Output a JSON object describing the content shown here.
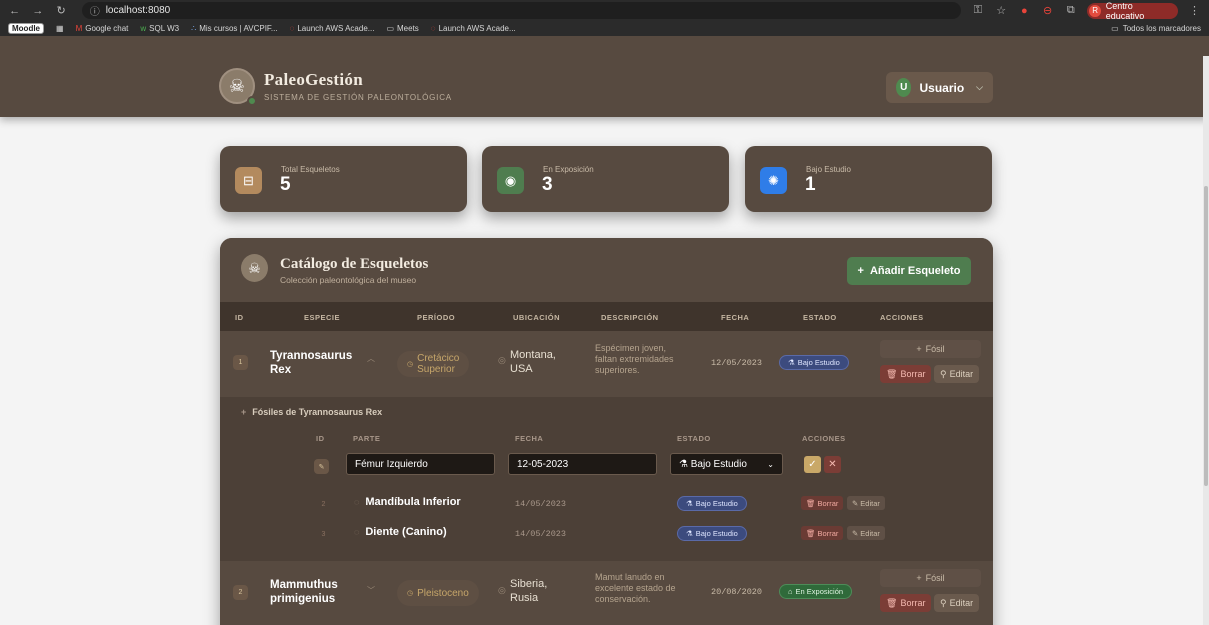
{
  "browser": {
    "url": "localhost:8080",
    "profile_label": "Centro educativo",
    "profile_initial": "R",
    "bookmarks": [
      "Moodle",
      "Google chat",
      "SQL W3",
      "Mis cursos | AVCPIF...",
      "Launch AWS Acade...",
      "Meets",
      "Launch AWS Acade..."
    ],
    "all_bookmarks": "Todos los marcadores"
  },
  "header": {
    "brand": "PaleoGestión",
    "subtitle": "SISTEMA DE GESTIÓN PALEONTOLÓGICA",
    "user_initial": "U",
    "user_label": "Usuario"
  },
  "stats": [
    {
      "label": "Total Esqueletos",
      "value": "5",
      "color": "#b38a5e"
    },
    {
      "label": "En Exposición",
      "value": "3",
      "color": "#4f7d4f"
    },
    {
      "label": "Bajo Estudio",
      "value": "1",
      "color": "#2f7de8"
    }
  ],
  "catalog": {
    "title": "Catálogo de Esqueletos",
    "subtitle": "Colección paleontológica del museo",
    "add_button": "Añadir Esqueleto",
    "columns": [
      "ID",
      "ESPECIE",
      "PERÍODO",
      "UBICACIÓN",
      "DESCRIPCIÓN",
      "FECHA",
      "ESTADO",
      "ACCIONES"
    ],
    "rows": [
      {
        "id": "1",
        "species_1": "Tyrannosaurus",
        "species_2": "Rex",
        "period_1": "Cretácico",
        "period_2": "Superior",
        "location_1": "Montana,",
        "location_2": "USA",
        "desc_1": "Espécimen joven,",
        "desc_2": "faltan extremidades",
        "desc_3": "superiores.",
        "date": "12/05/2023",
        "state": "Bajo Estudio",
        "fossil_btn": "Fósil",
        "delete_btn": "Borrar",
        "edit_btn": "Editar"
      },
      {
        "id": "2",
        "species_1": "Mammuthus",
        "species_2": "primigenius",
        "period_1": "Pleistoceno",
        "location_1": "Siberia,",
        "location_2": "Rusia",
        "desc_1": "Mamut lanudo en",
        "desc_2": "excelente estado de",
        "desc_3": "conservación.",
        "date": "20/08/2020",
        "state": "En Exposición",
        "fossil_btn": "Fósil",
        "delete_btn": "Borrar",
        "edit_btn": "Editar"
      }
    ],
    "fossils": {
      "title": "Fósiles de Tyrannosaurus Rex",
      "columns": [
        "ID",
        "PARTE",
        "FECHA",
        "ESTADO",
        "ACCIONES"
      ],
      "edit_row": {
        "name_value": "Fémur Izquierdo",
        "date_value": "12-05-2023",
        "state_value": "Bajo Estudio"
      },
      "items": [
        {
          "id": "2",
          "name": "Mandíbula Inferior",
          "date": "14/05/2023",
          "state": "Bajo Estudio",
          "delete_btn": "Borrar",
          "edit_btn": "Editar"
        },
        {
          "id": "3",
          "name": "Diente (Canino)",
          "date": "14/05/2023",
          "state": "Bajo Estudio",
          "delete_btn": "Borrar",
          "edit_btn": "Editar"
        }
      ]
    }
  }
}
